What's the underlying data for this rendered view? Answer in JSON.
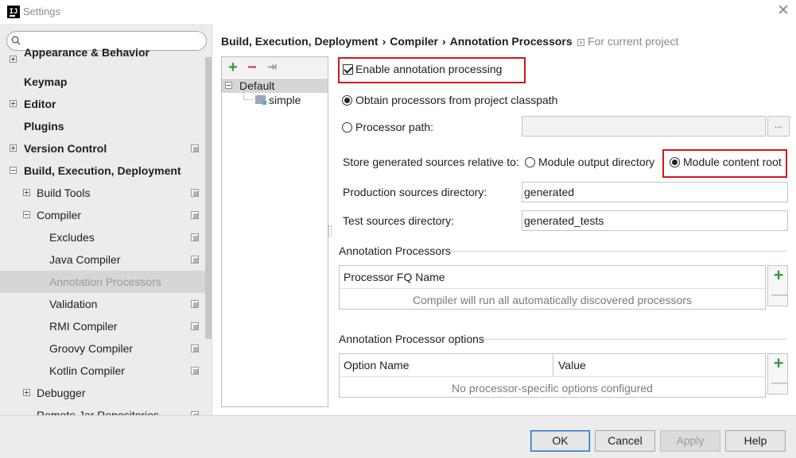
{
  "window": {
    "title": "Settings"
  },
  "search": {
    "placeholder": ""
  },
  "sidebar": {
    "items": [
      {
        "label": "Appearance & Behavior"
      },
      {
        "label": "Keymap"
      },
      {
        "label": "Editor"
      },
      {
        "label": "Plugins"
      },
      {
        "label": "Version Control"
      },
      {
        "label": "Build, Execution, Deployment"
      },
      {
        "label": "Build Tools"
      },
      {
        "label": "Compiler"
      },
      {
        "label": "Excludes"
      },
      {
        "label": "Java Compiler"
      },
      {
        "label": "Annotation Processors"
      },
      {
        "label": "Validation"
      },
      {
        "label": "RMI Compiler"
      },
      {
        "label": "Groovy Compiler"
      },
      {
        "label": "Kotlin Compiler"
      },
      {
        "label": "Debugger"
      },
      {
        "label": "Remote Jar Repositories"
      }
    ]
  },
  "breadcrumb": {
    "part1": "Build, Execution, Deployment",
    "part2": "Compiler",
    "part3": "Annotation Processors",
    "separator": "›",
    "scope": "For current project"
  },
  "profiles": {
    "add": "+",
    "remove": "−",
    "move": "⇥",
    "default_label": "Default",
    "module_label": "simple"
  },
  "form": {
    "enable_label": "Enable annotation processing",
    "enable_checked": true,
    "obtain_label": "Obtain processors from project classpath",
    "path_label": "Processor path:",
    "path_value": "",
    "browse_label": "...",
    "store_label": "Store generated sources relative to:",
    "module_output_label": "Module output directory",
    "module_content_label": "Module content root",
    "production_label": "Production sources directory:",
    "production_value": "generated",
    "test_label": "Test sources directory:",
    "test_value": "generated_tests"
  },
  "processors": {
    "section_title": "Annotation Processors",
    "column": "Processor FQ Name",
    "empty": "Compiler will run all automatically discovered processors",
    "add": "+",
    "remove": "—"
  },
  "options": {
    "section_title": "Annotation Processor options",
    "columns": [
      "Option Name",
      "Value"
    ],
    "empty": "No processor-specific options configured",
    "add": "+",
    "remove": "—"
  },
  "buttons": {
    "ok": "OK",
    "cancel": "Cancel",
    "apply": "Apply",
    "help": "Help"
  },
  "colors": {
    "highlight": "#d01818",
    "add": "#3a9a3a",
    "remove": "#d04040",
    "sidebar_bg": "#ececec"
  }
}
